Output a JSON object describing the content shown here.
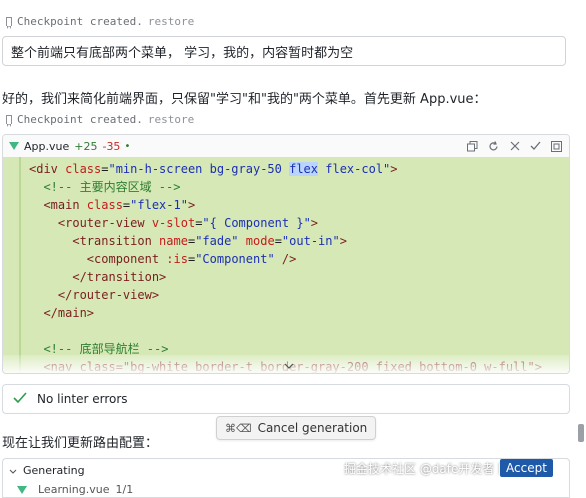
{
  "checkpoints": [
    {
      "text": "Checkpoint created.",
      "action": "restore"
    },
    {
      "text": "Checkpoint created.",
      "action": "restore"
    }
  ],
  "user_message": "整个前端只有底部两个菜单， 学习，我的，内容暂时都为空",
  "assistant_text": "好的，我们来简化前端界面，只保留\"学习\"和\"我的\"两个菜单。首先更新 App.vue：",
  "code_card": {
    "filename": "App.vue",
    "additions": "+25",
    "deletions": "-35",
    "status_dot": "•",
    "actions": [
      "copy-icon",
      "refresh-icon",
      "close-icon",
      "check-icon",
      "apply-icon"
    ]
  },
  "code_lines": [
    [
      {
        "t": "<div ",
        "c": "tag"
      },
      {
        "t": "class",
        "c": "attr"
      },
      {
        "t": "=",
        "c": "plain"
      },
      {
        "t": "\"min-h-screen bg-gray-50 ",
        "c": "str"
      },
      {
        "t": "flex",
        "c": "str hl"
      },
      {
        "t": " flex-col\"",
        "c": "str"
      },
      {
        "t": ">",
        "c": "tag"
      }
    ],
    [
      {
        "t": "  <!-- 主要内容区域 -->",
        "c": "cmt"
      }
    ],
    [
      {
        "t": "  <main ",
        "c": "tag"
      },
      {
        "t": "class",
        "c": "attr"
      },
      {
        "t": "=",
        "c": "plain"
      },
      {
        "t": "\"flex-1\"",
        "c": "str"
      },
      {
        "t": ">",
        "c": "tag"
      }
    ],
    [
      {
        "t": "    <router-view ",
        "c": "tag"
      },
      {
        "t": "v-slot",
        "c": "attr"
      },
      {
        "t": "=",
        "c": "plain"
      },
      {
        "t": "\"{ Component }\"",
        "c": "str"
      },
      {
        "t": ">",
        "c": "tag"
      }
    ],
    [
      {
        "t": "      <transition ",
        "c": "tag"
      },
      {
        "t": "name",
        "c": "attr"
      },
      {
        "t": "=",
        "c": "plain"
      },
      {
        "t": "\"fade\"",
        "c": "str"
      },
      {
        "t": " ",
        "c": "plain"
      },
      {
        "t": "mode",
        "c": "attr"
      },
      {
        "t": "=",
        "c": "plain"
      },
      {
        "t": "\"out-in\"",
        "c": "str"
      },
      {
        "t": ">",
        "c": "tag"
      }
    ],
    [
      {
        "t": "        <component ",
        "c": "tag"
      },
      {
        "t": ":is",
        "c": "attr"
      },
      {
        "t": "=",
        "c": "plain"
      },
      {
        "t": "\"Component\"",
        "c": "str"
      },
      {
        "t": " />",
        "c": "tag"
      }
    ],
    [
      {
        "t": "      </transition>",
        "c": "tag"
      }
    ],
    [
      {
        "t": "    </router-view>",
        "c": "tag"
      }
    ],
    [
      {
        "t": "  </main>",
        "c": "tag"
      }
    ],
    [
      {
        "t": "",
        "c": "plain"
      }
    ],
    [
      {
        "t": "  <!-- 底部导航栏 -->",
        "c": "cmt"
      }
    ],
    [
      {
        "t": "  <nav class=\"bg-white border-t border-gray-200 fixed bottom-0 w-full\">",
        "c": "tag"
      }
    ]
  ],
  "linter": {
    "text": "No linter errors"
  },
  "cancel": {
    "shortcut": "⌘⌫",
    "label": "Cancel generation"
  },
  "next_text": "现在让我们更新路由配置：",
  "generating": {
    "label": "Generating",
    "file": "Learning.vue",
    "file_meta": "1/1"
  },
  "watermark": "掘金技术社区 @dafe开发者 阿乐",
  "badge": "Accept"
}
